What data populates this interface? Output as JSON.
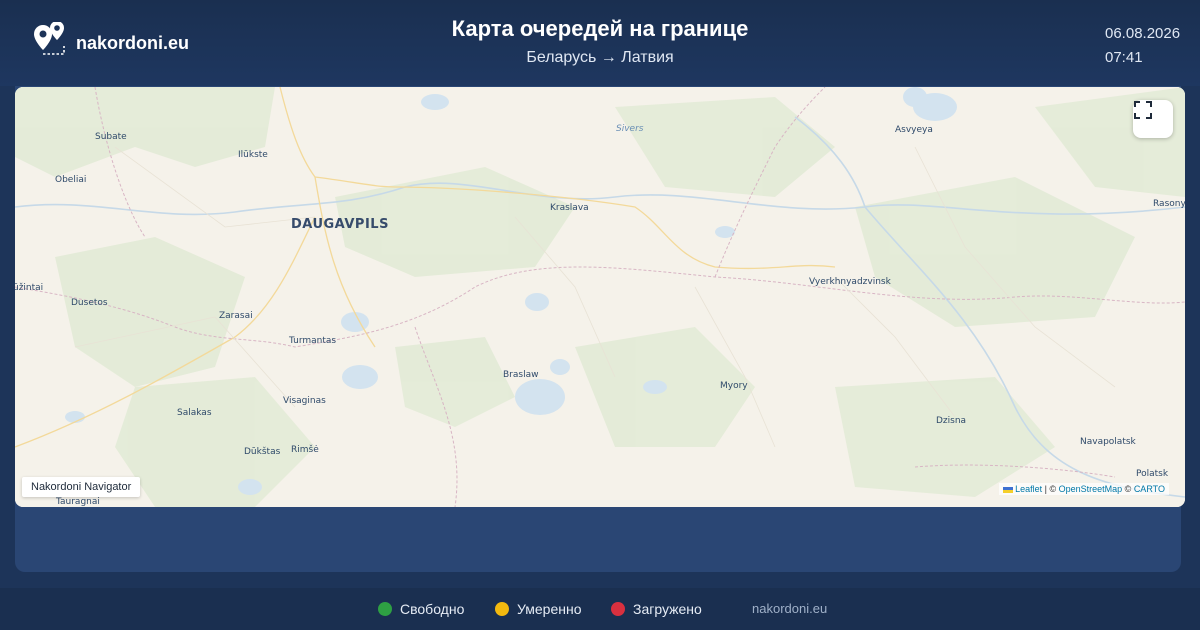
{
  "header": {
    "brand": "nakordoni.eu",
    "title": "Карта очередей на границе",
    "route": "Беларусь → Латвия",
    "date": "06.08.2026",
    "time": "07:41"
  },
  "map": {
    "places": [
      {
        "id": "subate",
        "label": "Subate"
      },
      {
        "id": "ilukste",
        "label": "Ilūkste"
      },
      {
        "id": "obeliai",
        "label": "Obeliai"
      },
      {
        "id": "daugavpils",
        "label": "DAUGAVPILS"
      },
      {
        "id": "kraslava",
        "label": "Kraslava"
      },
      {
        "id": "sivers",
        "label": "Sivers"
      },
      {
        "id": "asvyeya",
        "label": "Asvyeya"
      },
      {
        "id": "rasony",
        "label": "Rasony"
      },
      {
        "id": "uzintai",
        "label": "ūžintai"
      },
      {
        "id": "dusetos",
        "label": "Dusetos"
      },
      {
        "id": "zarasai",
        "label": "Zarasai"
      },
      {
        "id": "turmantas",
        "label": "Turmantas"
      },
      {
        "id": "verkhnyadzvinsk",
        "label": "Vyerkhnyadzvinsk"
      },
      {
        "id": "braslaw",
        "label": "Braslaw"
      },
      {
        "id": "myory",
        "label": "Myory"
      },
      {
        "id": "salakas",
        "label": "Salakas"
      },
      {
        "id": "visaginas",
        "label": "Visaginas"
      },
      {
        "id": "dzisna",
        "label": "Dzisna"
      },
      {
        "id": "dukstas",
        "label": "Dūkštas"
      },
      {
        "id": "rimse",
        "label": "Rimšė"
      },
      {
        "id": "navapolatsk",
        "label": "Navapolatsk"
      },
      {
        "id": "polatsk",
        "label": "Polatsk"
      },
      {
        "id": "tauragnai",
        "label": "Tauragnai"
      }
    ],
    "navigator_label": "Nakordoni Navigator",
    "fullscreen_icon": "fullscreen-icon",
    "attribution": {
      "leaflet": "Leaflet",
      "sep1": " | © ",
      "osm": "OpenStreetMap",
      "sep2": " © ",
      "carto": "CARTO"
    }
  },
  "legend": [
    {
      "label": "Свободно",
      "color": "#2ea043"
    },
    {
      "label": "Умеренно",
      "color": "#f2b90f"
    },
    {
      "label": "Загружено",
      "color": "#d9303f"
    }
  ],
  "footer": {
    "site": "nakordoni.eu"
  }
}
